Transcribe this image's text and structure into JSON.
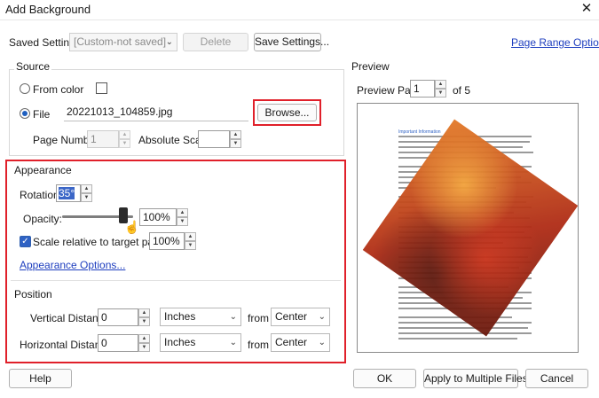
{
  "window": {
    "title": "Add Background",
    "close_glyph": "✕"
  },
  "top": {
    "saved_settings_label": "Saved Settings:",
    "saved_settings_value": "[Custom-not saved]",
    "delete_label": "Delete",
    "save_settings_label": "Save Settings...",
    "page_range_label": "Page Range Options..."
  },
  "source": {
    "title": "Source",
    "from_color_label": "From color",
    "file_label": "File",
    "file_name": "20221013_104859.jpg",
    "browse_label": "Browse...",
    "page_number_label": "Page Number:",
    "page_number_value": "1",
    "absolute_scale_label": "Absolute Scale:",
    "absolute_scale_value": ""
  },
  "appearance": {
    "title": "Appearance",
    "rotation_label": "Rotation:",
    "rotation_value": "35°",
    "opacity_label": "Opacity:",
    "opacity_value": "100%",
    "opacity_level": 1.0,
    "scale_label": "Scale relative to target page",
    "scale_value": "100%",
    "scale_checked": true,
    "options_link": "Appearance Options..."
  },
  "position": {
    "title": "Position",
    "vertical_label": "Vertical Distance:",
    "vertical_value": "0",
    "vertical_unit": "Inches",
    "vertical_from_label": "from",
    "vertical_from": "Center",
    "horizontal_label": "Horizontal Distance:",
    "horizontal_value": "0",
    "horizontal_unit": "Inches",
    "horizontal_from_label": "from",
    "horizontal_from": "Center"
  },
  "preview": {
    "title": "Preview",
    "page_label": "Preview Page",
    "page_value": "1",
    "of_label": "of 5",
    "doc_heading": "Important Information"
  },
  "footer": {
    "help_label": "Help",
    "ok_label": "OK",
    "apply_multiple_label": "Apply to Multiple Files",
    "cancel_label": "Cancel"
  },
  "colors": {
    "accent": "#2f62c4",
    "highlight": "#e0202a",
    "link": "#1f3fbf"
  }
}
